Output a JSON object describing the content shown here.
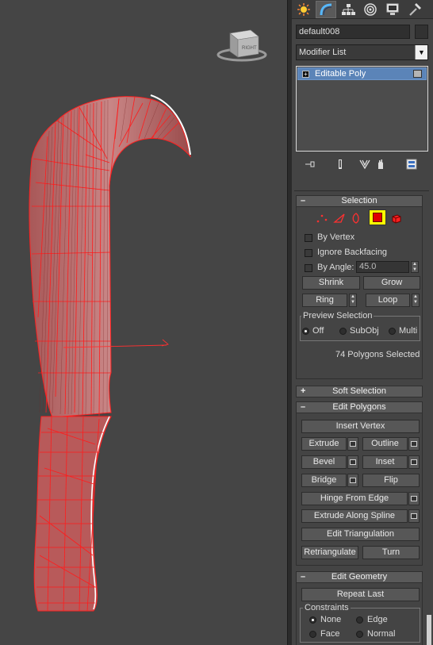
{
  "viewport": {
    "viewcube_label": "RIGHT",
    "mesh_color": "#cc3030"
  },
  "command_panel": {
    "tabs": [
      {
        "name": "create-tab",
        "icon": "sun-star-icon"
      },
      {
        "name": "modify-tab",
        "icon": "bend-arc-icon"
      },
      {
        "name": "hierarchy-tab",
        "icon": "hierarchy-icon"
      },
      {
        "name": "motion-tab",
        "icon": "motion-circle-icon"
      },
      {
        "name": "display-tab",
        "icon": "monitor-icon"
      },
      {
        "name": "utilities-tab",
        "icon": "hammer-icon"
      }
    ],
    "object_name": "default008",
    "modifier_list_label": "Modifier List",
    "modifier_stack": [
      {
        "label": "Editable Poly"
      }
    ],
    "stack_tools": [
      "pin-stack-icon",
      "show-end-result-icon",
      "make-unique-icon",
      "remove-modifier-icon",
      "configure-modifier-sets-icon"
    ]
  },
  "selection": {
    "title": "Selection",
    "subobject_icons": [
      "vertex-icon",
      "edge-icon",
      "border-icon",
      "polygon-icon",
      "element-icon"
    ],
    "by_vertex": "By Vertex",
    "ignore_backfacing": "Ignore Backfacing",
    "by_angle": "By Angle:",
    "angle_value": "45.0",
    "shrink": "Shrink",
    "grow": "Grow",
    "ring": "Ring",
    "loop": "Loop",
    "preview_selection": "Preview Selection",
    "preview_options": [
      "Off",
      "SubObj",
      "Multi"
    ],
    "status": "74 Polygons Selected"
  },
  "soft_selection": {
    "title": "Soft Selection"
  },
  "edit_polygons": {
    "title": "Edit Polygons",
    "insert_vertex": "Insert Vertex",
    "extrude": "Extrude",
    "outline": "Outline",
    "bevel": "Bevel",
    "inset": "Inset",
    "bridge": "Bridge",
    "flip": "Flip",
    "hinge_from_edge": "Hinge From Edge",
    "extrude_along_spline": "Extrude Along Spline",
    "edit_triangulation": "Edit Triangulation",
    "retriangulate": "Retriangulate",
    "turn": "Turn"
  },
  "edit_geometry": {
    "title": "Edit Geometry",
    "repeat_last": "Repeat Last",
    "constraints": "Constraints",
    "constraint_options": [
      "None",
      "Edge",
      "Face",
      "Normal"
    ]
  }
}
